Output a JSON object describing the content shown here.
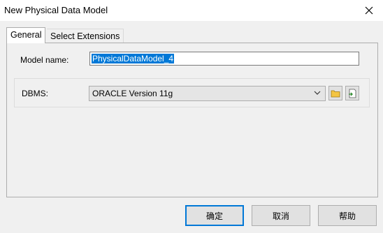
{
  "window": {
    "title": "New Physical Data Model",
    "close_icon": "close-icon"
  },
  "tabs": [
    {
      "label": "General",
      "active": true
    },
    {
      "label": "Select Extensions",
      "active": false
    }
  ],
  "general": {
    "model_name_label": "Model name:",
    "model_name_value": "PhysicalDataModel_4",
    "dbms_label": "DBMS:",
    "dbms_value": "ORACLE Version 11g",
    "dbms_icons": [
      "folder-icon",
      "document-arrow-icon"
    ]
  },
  "buttons": {
    "ok": "确定",
    "cancel": "取消",
    "help": "帮助"
  },
  "colors": {
    "selection": "#0078d7",
    "default_button_border": "#0078d7"
  }
}
